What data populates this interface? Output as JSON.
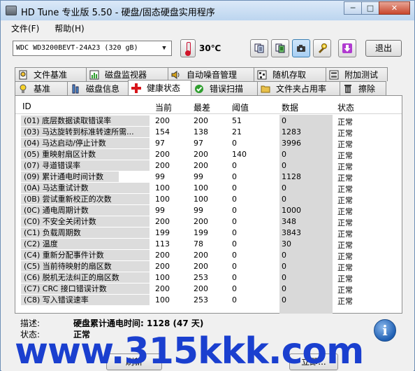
{
  "window": {
    "title": "HD Tune 专业版 5.50 - 硬盘/固态硬盘实用程序",
    "minimize_glyph": "─",
    "maximize_glyph": "□",
    "close_glyph": "✕"
  },
  "menu": {
    "items": [
      "文件(F)",
      "帮助(H)"
    ]
  },
  "toolbar": {
    "drive": "WDC WD3200BEVT-24A23 (320 gB)",
    "temperature": "30℃",
    "exit_label": "退出",
    "icons": [
      "copy-info-icon",
      "copy-screen-icon",
      "camera-icon",
      "options-wrench-icon",
      "save-download-icon"
    ]
  },
  "tabs": {
    "row1": [
      {
        "label": "文件基准",
        "icon": "file-benchmark-icon"
      },
      {
        "label": "磁盘监视器",
        "icon": "disk-monitor-icon"
      },
      {
        "label": "自动噪音管理",
        "icon": "speaker-icon"
      },
      {
        "label": "随机存取",
        "icon": "random-access-icon"
      },
      {
        "label": "附加测试",
        "icon": "extra-tests-icon"
      }
    ],
    "row2": [
      {
        "label": "基准",
        "icon": "benchmark-bulb-icon"
      },
      {
        "label": "磁盘信息",
        "icon": "disk-info-icon"
      },
      {
        "label": "健康状态",
        "icon": "health-cross-icon",
        "active": true
      },
      {
        "label": "错误扫描",
        "icon": "error-scan-icon"
      },
      {
        "label": "文件夹占用率",
        "icon": "folder-icon"
      },
      {
        "label": "擦除",
        "icon": "trash-icon"
      }
    ]
  },
  "smart": {
    "headers": {
      "id": "ID",
      "current": "当前",
      "worst": "最差",
      "threshold": "阈值",
      "data": "数据",
      "status": "状态"
    },
    "rows": [
      {
        "id": "(01) 底层数据读取错误率",
        "current": "200",
        "worst": "200",
        "threshold": "51",
        "data": "0",
        "status": "正常"
      },
      {
        "id": "(03) 马达旋转到标准转速所需...",
        "current": "154",
        "worst": "138",
        "threshold": "21",
        "data": "1283",
        "status": "正常"
      },
      {
        "id": "(04) 马达启动/停止计数",
        "current": "97",
        "worst": "97",
        "threshold": "0",
        "data": "3996",
        "status": "正常"
      },
      {
        "id": "(05) 重映射扇区计数",
        "current": "200",
        "worst": "200",
        "threshold": "140",
        "data": "0",
        "status": "正常"
      },
      {
        "id": "(07) 寻道错误率",
        "current": "200",
        "worst": "200",
        "threshold": "0",
        "data": "0",
        "status": "正常"
      },
      {
        "id": "(09) 累计通电时间计数",
        "current": "99",
        "worst": "99",
        "threshold": "0",
        "data": "1128",
        "status": "正常"
      },
      {
        "id": "(0A) 马达重试计数",
        "current": "100",
        "worst": "100",
        "threshold": "0",
        "data": "0",
        "status": "正常"
      },
      {
        "id": "(0B) 尝试重新校正的次数",
        "current": "100",
        "worst": "100",
        "threshold": "0",
        "data": "0",
        "status": "正常"
      },
      {
        "id": "(0C) 通电周期计数",
        "current": "99",
        "worst": "99",
        "threshold": "0",
        "data": "1000",
        "status": "正常"
      },
      {
        "id": "(C0) 不安全关闭计数",
        "current": "200",
        "worst": "200",
        "threshold": "0",
        "data": "348",
        "status": "正常"
      },
      {
        "id": "(C1) 负载周期数",
        "current": "199",
        "worst": "199",
        "threshold": "0",
        "data": "3843",
        "status": "正常"
      },
      {
        "id": "(C2) 温度",
        "current": "113",
        "worst": "78",
        "threshold": "0",
        "data": "30",
        "status": "正常"
      },
      {
        "id": "(C4) 重新分配事件计数",
        "current": "200",
        "worst": "200",
        "threshold": "0",
        "data": "0",
        "status": "正常"
      },
      {
        "id": "(C5) 当前待映射的扇区数",
        "current": "200",
        "worst": "200",
        "threshold": "0",
        "data": "0",
        "status": "正常"
      },
      {
        "id": "(C6) 脱机无法纠正的扇区数",
        "current": "100",
        "worst": "253",
        "threshold": "0",
        "data": "0",
        "status": "正常"
      },
      {
        "id": "(C7) CRC 接口错误计数",
        "current": "200",
        "worst": "200",
        "threshold": "0",
        "data": "0",
        "status": "正常"
      },
      {
        "id": "(C8) 写入错误速率",
        "current": "100",
        "worst": "253",
        "threshold": "0",
        "data": "0",
        "status": "正常"
      }
    ]
  },
  "details": {
    "desc_label": "描述:",
    "desc_value": "硬盘累计通电时间: 1128 (47 天)",
    "status_label": "状态:",
    "status_value": "正常"
  },
  "bottom": {
    "refresh_fragment": "刷新",
    "immediate_fragment": "立即..."
  },
  "watermark": "www.315kkk.com"
}
